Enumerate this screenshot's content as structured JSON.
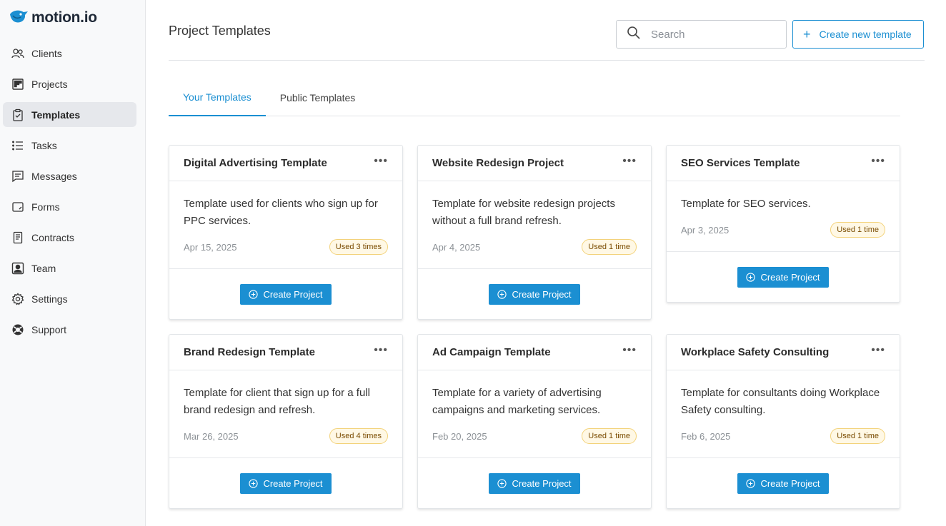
{
  "brand": {
    "name": "motion.io"
  },
  "sidebar": {
    "items": [
      {
        "label": "Clients",
        "icon": "users-icon"
      },
      {
        "label": "Projects",
        "icon": "kanban-icon"
      },
      {
        "label": "Templates",
        "icon": "clipboard-check-icon",
        "active": true
      },
      {
        "label": "Tasks",
        "icon": "list-icon"
      },
      {
        "label": "Messages",
        "icon": "message-icon"
      },
      {
        "label": "Forms",
        "icon": "form-icon"
      },
      {
        "label": "Contracts",
        "icon": "document-icon"
      },
      {
        "label": "Team",
        "icon": "team-icon"
      },
      {
        "label": "Settings",
        "icon": "gear-icon"
      },
      {
        "label": "Support",
        "icon": "lifebuoy-icon"
      }
    ]
  },
  "header": {
    "title": "Project Templates",
    "search_placeholder": "Search",
    "create_label": "Create new template"
  },
  "tabs": [
    {
      "label": "Your Templates",
      "active": true
    },
    {
      "label": "Public Templates",
      "active": false
    }
  ],
  "cards": [
    {
      "title": "Digital Advertising Template",
      "description": "Template used for clients who sign up for PPC services.",
      "date": "Apr 15, 2025",
      "usage": "Used 3 times",
      "button": "Create Project"
    },
    {
      "title": "Website Redesign Project",
      "description": "Template for website redesign projects without a full brand refresh.",
      "date": "Apr 4, 2025",
      "usage": "Used 1 time",
      "button": "Create Project"
    },
    {
      "title": "SEO Services Template",
      "description": "Template for SEO services.",
      "date": "Apr 3, 2025",
      "usage": "Used 1 time",
      "button": "Create Project"
    },
    {
      "title": "Brand Redesign Template",
      "description": "Template for client that sign up for a full brand redesign and refresh.",
      "date": "Mar 26, 2025",
      "usage": "Used 4 times",
      "button": "Create Project"
    },
    {
      "title": "Ad Campaign Template",
      "description": "Template for a variety of advertising campaigns and marketing services.",
      "date": "Feb 20, 2025",
      "usage": "Used 1 time",
      "button": "Create Project"
    },
    {
      "title": "Workplace Safety Consulting",
      "description": "Template for consultants doing Workplace Safety consulting.",
      "date": "Feb 6, 2025",
      "usage": "Used 1 time",
      "button": "Create Project"
    }
  ],
  "colors": {
    "accent": "#1b8fd2",
    "badge_bg": "#fff8e5",
    "badge_border": "#f3d27a"
  }
}
